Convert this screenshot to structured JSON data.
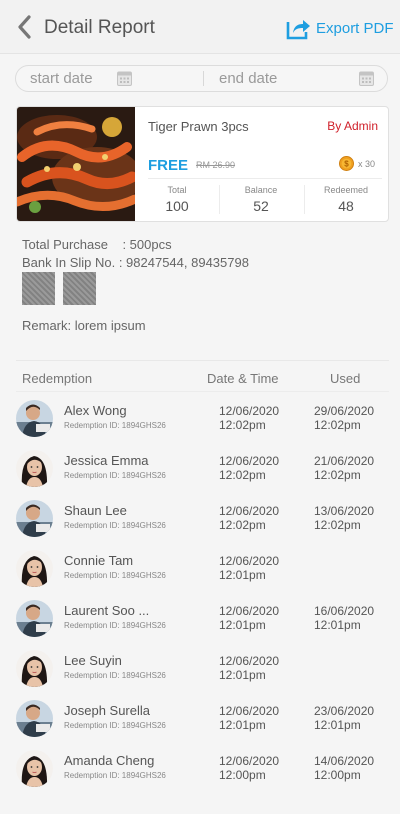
{
  "header": {
    "title": "Detail Report",
    "export_label": "Export PDF",
    "back_icon": "chevron-left-icon",
    "export_icon": "share-export-icon"
  },
  "date_range": {
    "start_placeholder": "start date",
    "end_placeholder": "end date"
  },
  "product": {
    "name": "Tiger Prawn 3pcs",
    "issuer": "By Admin",
    "price_label": "FREE",
    "original_price": "RM 26.90",
    "coin_count": "x 30",
    "stats": [
      {
        "label": "Total",
        "value": "100"
      },
      {
        "label": "Balance",
        "value": "52"
      },
      {
        "label": "Redeemed",
        "value": "48"
      }
    ]
  },
  "summary": {
    "total_purchase": "Total Purchase    : 500pcs",
    "bank_slip": "Bank In Slip No. : 98247544, 89435798",
    "remark": "Remark: lorem ipsum"
  },
  "table": {
    "headers": {
      "redemption": "Redemption",
      "datetime": "Date & Time",
      "used": "Used"
    },
    "rows": [
      {
        "name": "Alex Wong",
        "rid": "Redemption ID: 1894GHS26",
        "date": "12/06/2020",
        "time": "12:02pm",
        "used_date": "29/06/2020",
        "used_time": "12:02pm",
        "avatar": "male"
      },
      {
        "name": "Jessica Emma",
        "rid": "Redemption ID: 1894GHS26",
        "date": "12/06/2020",
        "time": "12:02pm",
        "used_date": "21/06/2020",
        "used_time": "12:02pm",
        "avatar": "female"
      },
      {
        "name": "Shaun Lee",
        "rid": "Redemption ID: 1894GHS26",
        "date": "12/06/2020",
        "time": "12:02pm",
        "used_date": "13/06/2020",
        "used_time": "12:02pm",
        "avatar": "male"
      },
      {
        "name": "Connie Tam",
        "rid": "Redemption ID: 1894GHS26",
        "date": "12/06/2020",
        "time": "12:01pm",
        "used_date": "",
        "used_time": "",
        "avatar": "female"
      },
      {
        "name": "Laurent Soo ...",
        "rid": "Redemption ID: 1894GHS26",
        "date": "12/06/2020",
        "time": "12:01pm",
        "used_date": "16/06/2020",
        "used_time": "12:01pm",
        "avatar": "male"
      },
      {
        "name": "Lee Suyin",
        "rid": "Redemption ID: 1894GHS26",
        "date": "12/06/2020",
        "time": "12:01pm",
        "used_date": "",
        "used_time": "",
        "avatar": "female"
      },
      {
        "name": "Joseph Surella",
        "rid": "Redemption ID: 1894GHS26",
        "date": "12/06/2020",
        "time": "12:01pm",
        "used_date": "23/06/2020",
        "used_time": "12:01pm",
        "avatar": "male"
      },
      {
        "name": "Amanda Cheng",
        "rid": "Redemption ID: 1894GHS26",
        "date": "12/06/2020",
        "time": "12:00pm",
        "used_date": "14/06/2020",
        "used_time": "12:00pm",
        "avatar": "female"
      }
    ]
  },
  "colors": {
    "accent": "#1e9ee0",
    "issuer_red": "#d0202a",
    "coin": "#f0a020"
  }
}
